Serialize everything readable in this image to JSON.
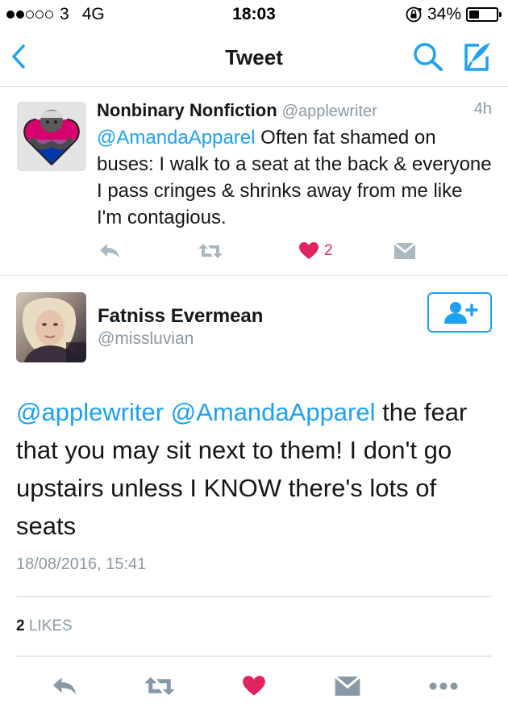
{
  "status_bar": {
    "carrier": "3",
    "network": "4G",
    "time": "18:03",
    "battery": "34%",
    "battery_level": 0.34,
    "signal_bars_filled": 2,
    "signal_bars_total": 5
  },
  "nav": {
    "title": "Tweet",
    "back_icon": "chevron-left-icon",
    "search_icon": "search-icon",
    "compose_icon": "compose-icon"
  },
  "reply_tweet": {
    "name": "Nonbinary Nonfiction",
    "handle": "@applewriter",
    "time": "4h",
    "mention": "@AmandaApparel",
    "text": "Often fat shamed on buses: I walk to a seat at the back & everyone I pass cringes & shrinks away from me like I'm contagious.",
    "like_count": "2"
  },
  "main_tweet": {
    "name": "Fatniss Evermean",
    "handle": "@missluvian",
    "mention_1": "@applewriter",
    "mention_2": "@AmandaApparel",
    "text": "the fear that you may sit next to them! I don't go upstairs unless I KNOW there's lots of seats",
    "date": "18/08/2016, 15:41",
    "likes_count": "2",
    "likes_label": "LIKES"
  },
  "colors": {
    "accent": "#1da1f2",
    "like": "#e0245e",
    "muted": "#8899a6",
    "text": "#14171a",
    "action_icon": "#aab8c2"
  }
}
